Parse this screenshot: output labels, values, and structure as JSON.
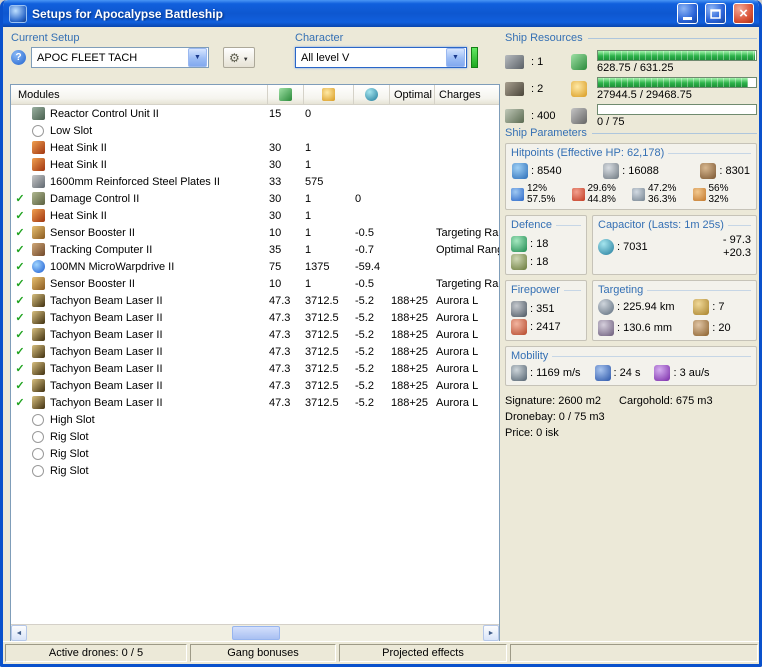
{
  "window": {
    "title": "Setups for Apocalypse Battleship"
  },
  "current_setup": {
    "label": "Current Setup",
    "help": "?",
    "value": "APOC FLEET TACH"
  },
  "character": {
    "label": "Character",
    "value": "All level V"
  },
  "ship_resources": {
    "label": "Ship Resources",
    "rows": [
      {
        "slot_icon": "turret-slots-icon",
        "slot_value": ": 1",
        "bar_icon": "cpu-icon",
        "bar_text": "628.75 / 631.25",
        "pct": 99.6
      },
      {
        "slot_icon": "launcher-slots-icon",
        "slot_value": ": 2",
        "bar_icon": "powergrid-icon",
        "bar_text": "27944.5 / 29468.75",
        "pct": 94.8
      },
      {
        "slot_icon": "calibration-icon",
        "slot_value": ": 400",
        "bar_icon": "dronebay-icon",
        "bar_text": "0 / 75",
        "pct": 0
      }
    ]
  },
  "modules": {
    "header": {
      "title": "Modules",
      "optimal": "Optimal",
      "charges": "Charges"
    },
    "rows": [
      {
        "check": "",
        "icon": "reactor-control-icon",
        "name": "Reactor Control Unit II",
        "cpu": "15",
        "pg": "0",
        "cap": "",
        "optimal": "",
        "charges": ""
      },
      {
        "check": "",
        "icon": "empty-slot-icon",
        "name": "Low Slot",
        "cpu": "",
        "pg": "",
        "cap": "",
        "optimal": "",
        "charges": ""
      },
      {
        "check": "",
        "icon": "heat-sink-icon",
        "name": "Heat Sink II",
        "cpu": "30",
        "pg": "1",
        "cap": "",
        "optimal": "",
        "charges": ""
      },
      {
        "check": "",
        "icon": "heat-sink-icon",
        "name": "Heat Sink II",
        "cpu": "30",
        "pg": "1",
        "cap": "",
        "optimal": "",
        "charges": ""
      },
      {
        "check": "",
        "icon": "armor-plate-icon",
        "name": "1600mm Reinforced Steel Plates II",
        "cpu": "33",
        "pg": "575",
        "cap": "",
        "optimal": "",
        "charges": ""
      },
      {
        "check": "✓",
        "icon": "damage-control-icon",
        "name": "Damage Control II",
        "cpu": "30",
        "pg": "1",
        "cap": "0",
        "optimal": "",
        "charges": ""
      },
      {
        "check": "✓",
        "icon": "heat-sink-icon",
        "name": "Heat Sink II",
        "cpu": "30",
        "pg": "1",
        "cap": "",
        "optimal": "",
        "charges": ""
      },
      {
        "check": "✓",
        "icon": "sensor-booster-icon",
        "name": "Sensor Booster II",
        "cpu": "10",
        "pg": "1",
        "cap": "-0.5",
        "optimal": "",
        "charges": "Targeting Ran"
      },
      {
        "check": "✓",
        "icon": "tracking-computer-icon",
        "name": "Tracking Computer II",
        "cpu": "35",
        "pg": "1",
        "cap": "-0.7",
        "optimal": "",
        "charges": "Optimal Rang"
      },
      {
        "check": "✓",
        "icon": "mwd-icon",
        "name": "100MN MicroWarpdrive II",
        "cpu": "75",
        "pg": "1375",
        "cap": "-59.4",
        "optimal": "",
        "charges": ""
      },
      {
        "check": "✓",
        "icon": "sensor-booster-icon",
        "name": "Sensor Booster II",
        "cpu": "10",
        "pg": "1",
        "cap": "-0.5",
        "optimal": "",
        "charges": "Targeting Ran"
      },
      {
        "check": "✓",
        "icon": "tachyon-laser-icon",
        "name": "Tachyon Beam Laser II",
        "cpu": "47.3",
        "pg": "3712.5",
        "cap": "-5.2",
        "optimal": "188+25",
        "charges": "Aurora L"
      },
      {
        "check": "✓",
        "icon": "tachyon-laser-icon",
        "name": "Tachyon Beam Laser II",
        "cpu": "47.3",
        "pg": "3712.5",
        "cap": "-5.2",
        "optimal": "188+25",
        "charges": "Aurora L"
      },
      {
        "check": "✓",
        "icon": "tachyon-laser-icon",
        "name": "Tachyon Beam Laser II",
        "cpu": "47.3",
        "pg": "3712.5",
        "cap": "-5.2",
        "optimal": "188+25",
        "charges": "Aurora L"
      },
      {
        "check": "✓",
        "icon": "tachyon-laser-icon",
        "name": "Tachyon Beam Laser II",
        "cpu": "47.3",
        "pg": "3712.5",
        "cap": "-5.2",
        "optimal": "188+25",
        "charges": "Aurora L"
      },
      {
        "check": "✓",
        "icon": "tachyon-laser-icon",
        "name": "Tachyon Beam Laser II",
        "cpu": "47.3",
        "pg": "3712.5",
        "cap": "-5.2",
        "optimal": "188+25",
        "charges": "Aurora L"
      },
      {
        "check": "✓",
        "icon": "tachyon-laser-icon",
        "name": "Tachyon Beam Laser II",
        "cpu": "47.3",
        "pg": "3712.5",
        "cap": "-5.2",
        "optimal": "188+25",
        "charges": "Aurora L"
      },
      {
        "check": "✓",
        "icon": "tachyon-laser-icon",
        "name": "Tachyon Beam Laser II",
        "cpu": "47.3",
        "pg": "3712.5",
        "cap": "-5.2",
        "optimal": "188+25",
        "charges": "Aurora L"
      },
      {
        "check": "",
        "icon": "empty-slot-icon",
        "name": "High Slot",
        "cpu": "",
        "pg": "",
        "cap": "",
        "optimal": "",
        "charges": ""
      },
      {
        "check": "",
        "icon": "empty-slot-icon",
        "name": "Rig Slot",
        "cpu": "",
        "pg": "",
        "cap": "",
        "optimal": "",
        "charges": ""
      },
      {
        "check": "",
        "icon": "empty-slot-icon",
        "name": "Rig Slot",
        "cpu": "",
        "pg": "",
        "cap": "",
        "optimal": "",
        "charges": ""
      },
      {
        "check": "",
        "icon": "empty-slot-icon",
        "name": "Rig Slot",
        "cpu": "",
        "pg": "",
        "cap": "",
        "optimal": "",
        "charges": ""
      }
    ]
  },
  "ship_parameters": {
    "label": "Ship Parameters",
    "hitpoints": {
      "label": "Hitpoints (Effective HP: 62,178)",
      "shield": ": 8540",
      "armor": ": 16088",
      "structure": ": 8301",
      "resists": [
        {
          "icon": "em-resist-icon",
          "top": "12%",
          "bottom": "57.5%"
        },
        {
          "icon": "thermal-resist-icon",
          "top": "29.6%",
          "bottom": "44.8%"
        },
        {
          "icon": "kinetic-resist-icon",
          "top": "47.2%",
          "bottom": "36.3%"
        },
        {
          "icon": "explosive-resist-icon",
          "top": "56%",
          "bottom": "32%"
        }
      ]
    },
    "defence": {
      "label": "Defence",
      "v1": ": 18",
      "v2": ": 18"
    },
    "capacitor": {
      "label": "Capacitor (Lasts: 1m 25s)",
      "value": ": 7031",
      "minus": "- 97.3",
      "plus": "+20.3"
    },
    "firepower": {
      "label": "Firepower",
      "volley": ": 351",
      "dps": ": 2417"
    },
    "targeting": {
      "label": "Targeting",
      "range": ": 225.94 km",
      "max_targets": ": 7",
      "scan_res": ": 130.6 mm",
      "sensor_str": ": 20"
    },
    "mobility": {
      "label": "Mobility",
      "speed": ": 1169 m/s",
      "align": ": 24 s",
      "warp": ": 3 au/s"
    },
    "summary": {
      "signature": "Signature: 2600 m2",
      "cargohold": "Cargohold: 675 m3",
      "dronebay": "Dronebay: 0 / 75 m3",
      "price": "Price: 0 isk"
    }
  },
  "statusbar": {
    "active_drones": "Active drones: 0 / 5",
    "gang_bonuses": "Gang bonuses",
    "projected_effects": "Projected effects"
  }
}
